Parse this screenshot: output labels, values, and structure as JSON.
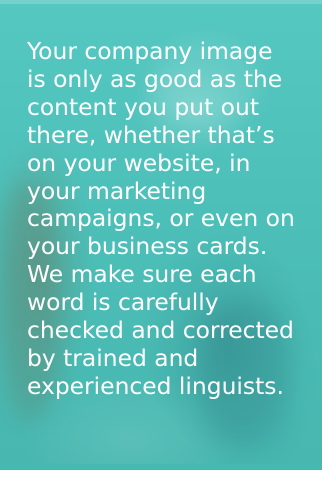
{
  "paragraph": {
    "lines": [
      "Your company image",
      "is only as good as the",
      "content you put out",
      "there, whether that’s",
      "on your website, in",
      "your marketing",
      "campaigns, or even on",
      "your business cards.",
      "We make sure each",
      "word is carefully",
      "checked and corrected",
      "by trained and",
      "experienced linguists."
    ]
  },
  "colors": {
    "overlay": "#4fc4bd",
    "text": "#ffffff"
  }
}
